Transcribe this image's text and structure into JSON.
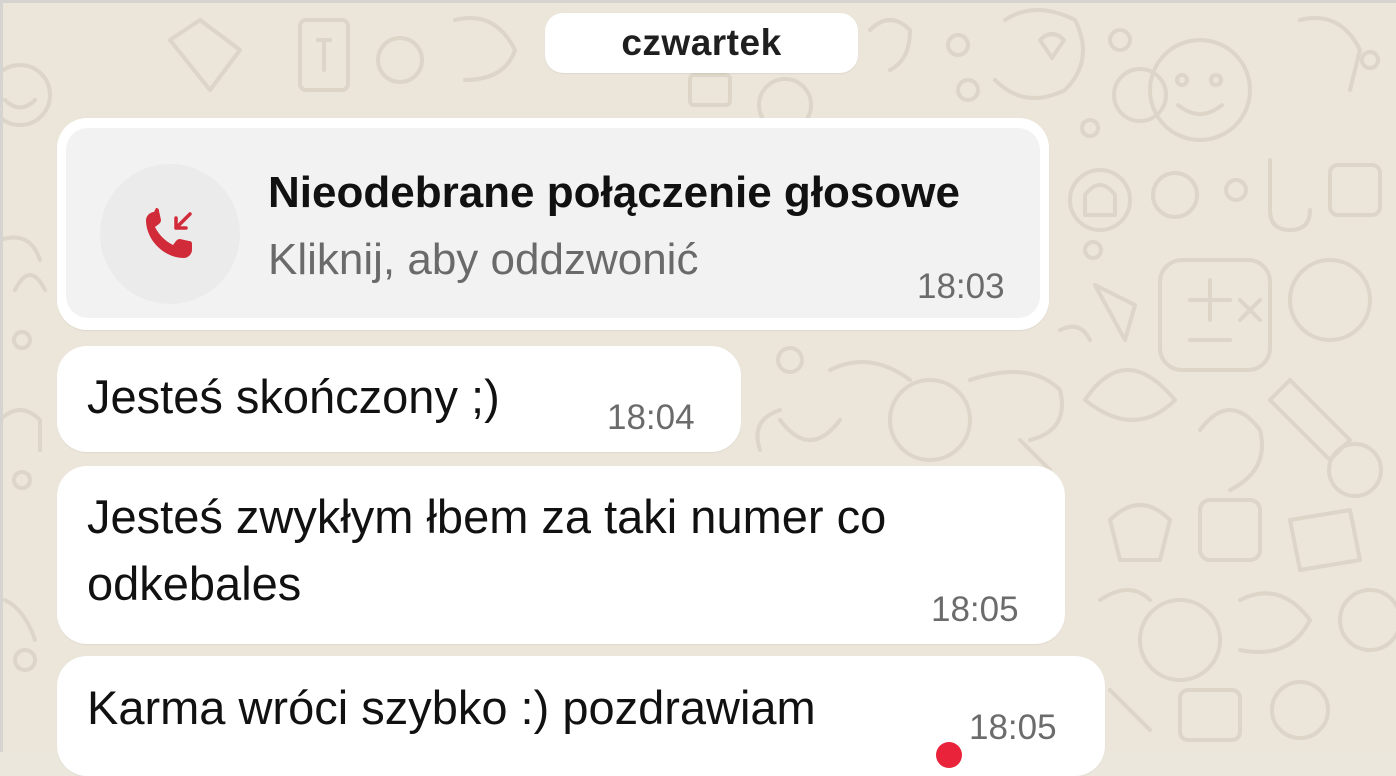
{
  "chat": {
    "date_separator": "czwartek",
    "missed_call": {
      "title": "Nieodebrane połączenie głosowe",
      "subtitle": "Kliknij, aby oddzwonić",
      "time": "18:03",
      "icon": "missed-call-icon",
      "icon_color": "#d12b3a"
    },
    "messages": [
      {
        "text": "Jesteś skończony ;)",
        "time": "18:04"
      },
      {
        "text_lines": [
          "Jesteś zwykłym łbem za taki numer co",
          "odkebales"
        ],
        "time": "18:05"
      },
      {
        "text": "Karma wróci szybko :) pozdrawiam",
        "time": "18:05"
      }
    ]
  },
  "colors": {
    "wallpaper": "#ebe5da",
    "bubble": "#ffffff",
    "call_card": "#f2f2f2"
  }
}
